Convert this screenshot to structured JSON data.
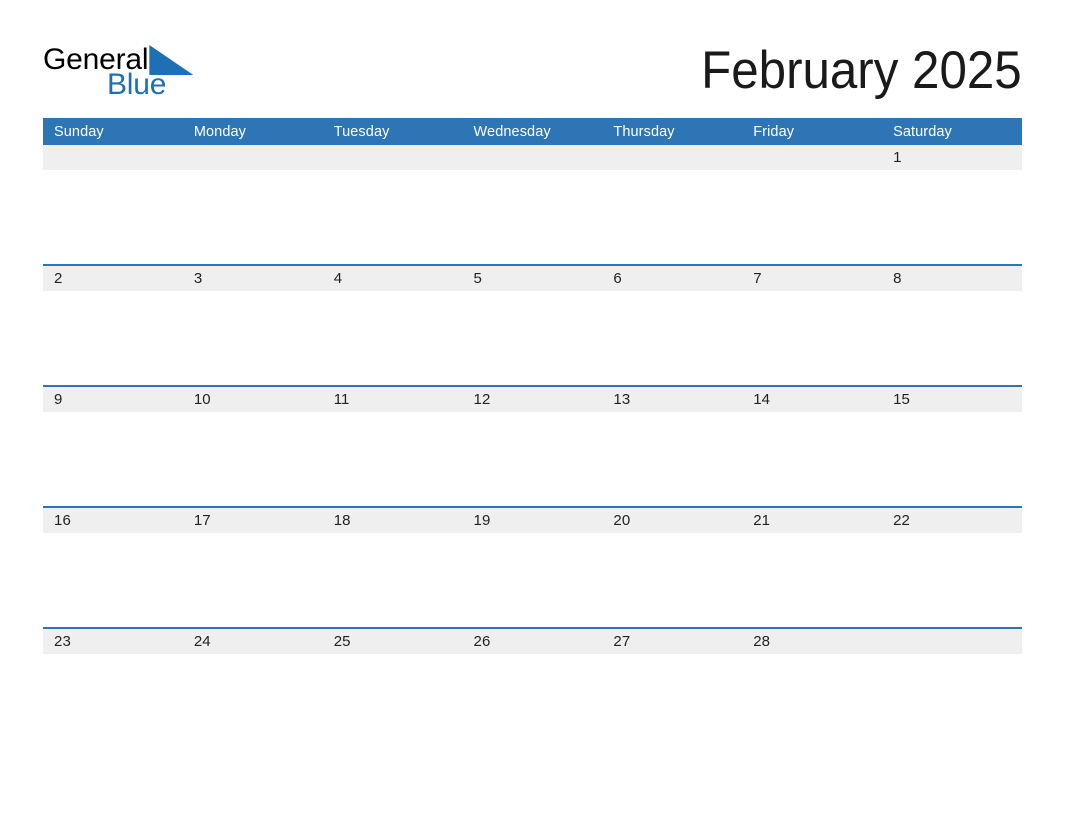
{
  "brand": {
    "name_part1": "General",
    "name_part2": "Blue",
    "triangle_color": "#1f6fb5"
  },
  "header": {
    "title": "February 2025",
    "month": "February",
    "year": "2025"
  },
  "theme": {
    "header_blue": "#2e75b6",
    "row_divider_blue": "#2e75b6",
    "date_band_gray": "#efefef",
    "page_background": "#ffffff",
    "text_dark": "#222222",
    "header_text": "#ffffff"
  },
  "weekdays": [
    "Sunday",
    "Monday",
    "Tuesday",
    "Wednesday",
    "Thursday",
    "Friday",
    "Saturday"
  ],
  "weeks": [
    [
      "",
      "",
      "",
      "",
      "",
      "",
      "1"
    ],
    [
      "2",
      "3",
      "4",
      "5",
      "6",
      "7",
      "8"
    ],
    [
      "9",
      "10",
      "11",
      "12",
      "13",
      "14",
      "15"
    ],
    [
      "16",
      "17",
      "18",
      "19",
      "20",
      "21",
      "22"
    ],
    [
      "23",
      "24",
      "25",
      "26",
      "27",
      "28",
      ""
    ]
  ]
}
